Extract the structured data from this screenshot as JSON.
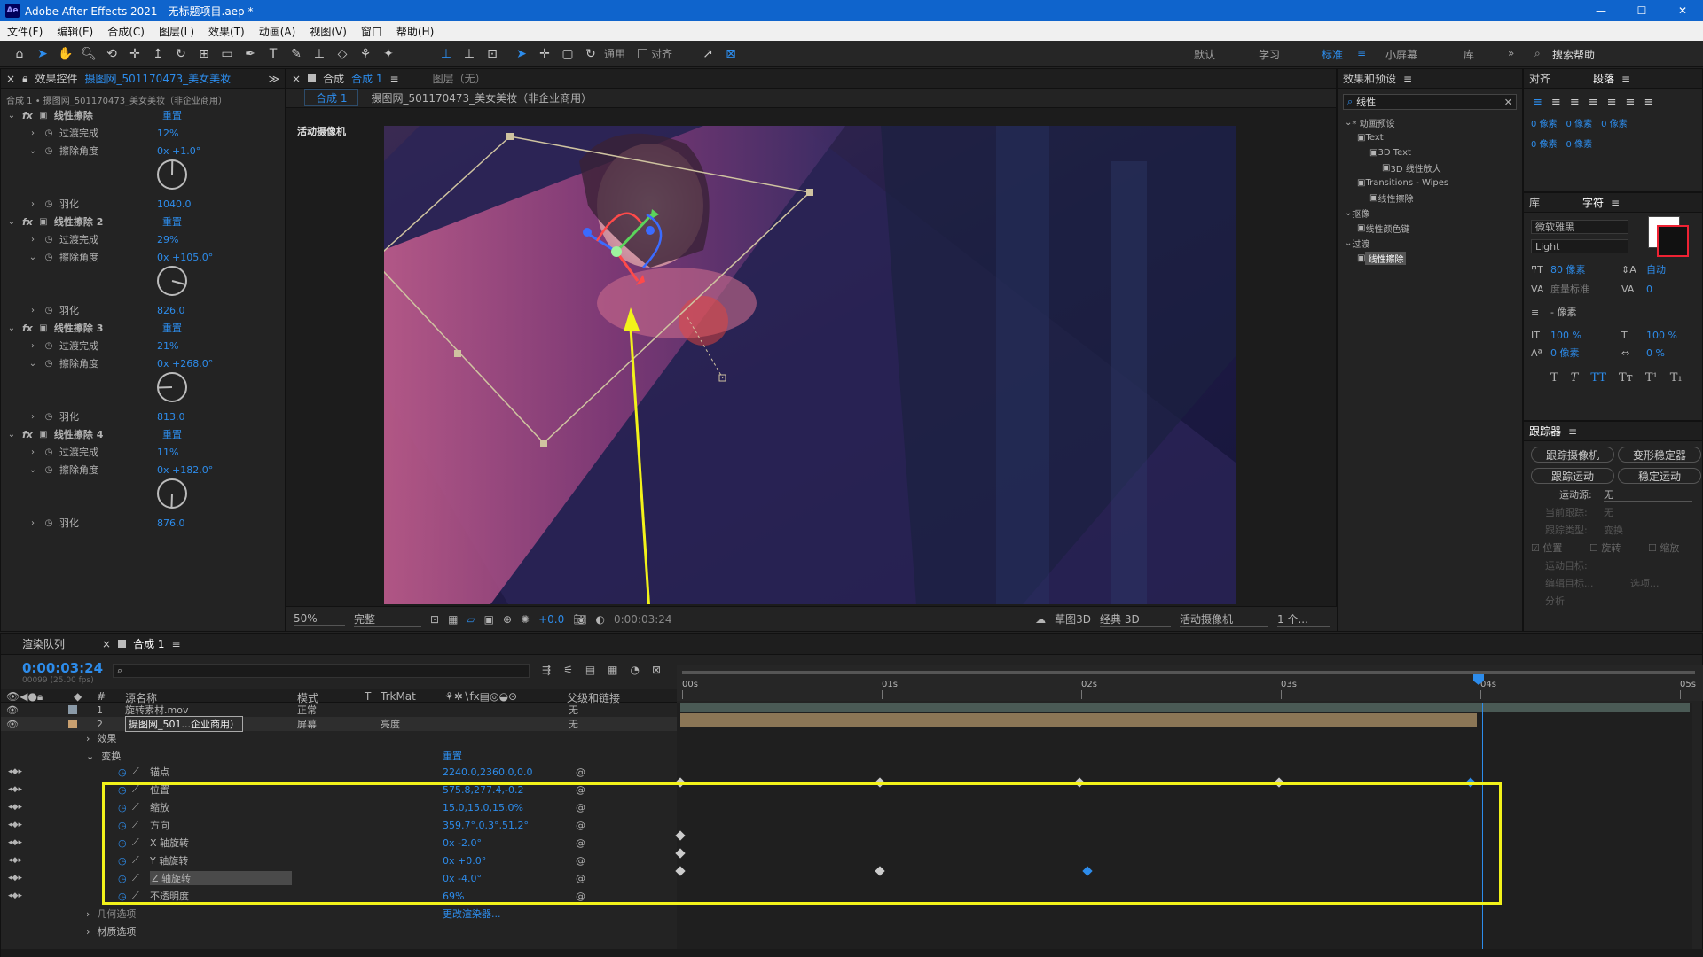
{
  "app": {
    "title": "Adobe After Effects 2021 - 无标题项目.aep *",
    "logo": "Ae",
    "window_controls": [
      "—",
      "☐",
      "✕"
    ]
  },
  "menu": [
    "文件(F)",
    "编辑(E)",
    "合成(C)",
    "图层(L)",
    "效果(T)",
    "动画(A)",
    "视图(V)",
    "窗口",
    "帮助(H)"
  ],
  "toolbar": {
    "snap_label": "对齐",
    "workspaces": [
      "默认",
      "学习",
      "标准",
      "小屏幕",
      "库"
    ],
    "active_workspace": "标准",
    "search_placeholder": "搜索帮助",
    "global_label": "通用"
  },
  "effect_controls": {
    "tab_label": "效果控件",
    "tab_layer": "摄图网_501170473_美女美妆",
    "breadcrumb": "合成 1 • 摄图网_501170473_美女美妆（非企业商用）",
    "effects": [
      {
        "name": "线性擦除",
        "reset": "重置",
        "completion": "12%",
        "angle": "0x +1.0°",
        "feather": "1040.0",
        "dial_deg": 1
      },
      {
        "name": "线性擦除 2",
        "reset": "重置",
        "completion": "29%",
        "angle": "0x +105.0°",
        "feather": "826.0",
        "dial_deg": 105
      },
      {
        "name": "线性擦除 3",
        "reset": "重置",
        "completion": "21%",
        "angle": "0x +268.0°",
        "feather": "813.0",
        "dial_deg": 268
      },
      {
        "name": "线性擦除 4",
        "reset": "重置",
        "completion": "11%",
        "angle": "0x +182.0°",
        "feather": "876.0",
        "dial_deg": 182
      }
    ],
    "prop_completion": "过渡完成",
    "prop_angle": "擦除角度",
    "prop_feather": "羽化"
  },
  "composition": {
    "tab_label": "合成",
    "tab_name": "合成 1",
    "layer_tab": "图层（无）",
    "breadcrumb_comp": "合成 1",
    "breadcrumb_layer": "摄图网_501170473_美女美妆（非企业商用）",
    "camera_label": "活动摄像机",
    "zoom": "50%",
    "quality": "完整",
    "exposure": "+0.0",
    "timecode": "0:00:03:24",
    "draft3d": "草图3D",
    "renderer": "经典 3D",
    "camera": "活动摄像机",
    "views": "1 个..."
  },
  "effects_presets": {
    "tab_label": "效果和预设",
    "search_value": "线性",
    "tree": [
      {
        "label": "* 动画预设",
        "indent": 0
      },
      {
        "label": "Text",
        "indent": 1
      },
      {
        "label": "3D Text",
        "indent": 2
      },
      {
        "label": "3D 线性放大",
        "indent": 3
      },
      {
        "label": "Transitions - Wipes",
        "indent": 1
      },
      {
        "label": "线性擦除",
        "indent": 2
      },
      {
        "label": "抠像",
        "indent": 0
      },
      {
        "label": "线性颜色键",
        "indent": 1
      },
      {
        "label": "过渡",
        "indent": 0
      },
      {
        "label": "线性擦除",
        "indent": 1
      }
    ]
  },
  "align_panel": {
    "tab1": "对齐",
    "tab2": "段落",
    "px_label": "0 像素"
  },
  "character_panel": {
    "tab1": "库",
    "tab2": "字符",
    "font": "微软雅黑",
    "weight": "Light",
    "size": "80 像素",
    "leading": "自动",
    "kerning": "度量标准",
    "tracking": "0",
    "stroke": "- 像素",
    "vscale": "100 %",
    "hscale": "100 %",
    "baseline": "0 像素",
    "tsume": "0 %",
    "styles": [
      "T",
      "T",
      "TT",
      "Tт",
      "T¹",
      "T₁"
    ]
  },
  "tracker_panel": {
    "title": "跟踪器",
    "buttons": [
      "跟踪摄像机",
      "变形稳定器",
      "跟踪运动",
      "稳定运动"
    ],
    "motion_source_label": "运动源:",
    "motion_source_value": "无",
    "current_track_label": "当前跟踪:",
    "current_track_value": "无",
    "track_type_label": "跟踪类型:",
    "track_type_value": "变换",
    "checks": [
      "位置",
      "旋转",
      "缩放"
    ],
    "motion_target_label": "运动目标:",
    "edit_target": "编辑目标...",
    "options": "选项...",
    "analyze": "分析"
  },
  "timeline": {
    "render_queue_tab": "渲染队列",
    "comp_tab": "合成 1",
    "current_time": "0:00:03:24",
    "frame_info": "00099 (25.00 fps)",
    "col_layer_name": "源名称",
    "col_mode": "模式",
    "col_t": "T",
    "col_trkmat": "TrkMat",
    "col_parent": "父级和链接",
    "ruler": [
      "00s",
      "01s",
      "02s",
      "03s",
      "04s",
      "05s"
    ],
    "layers": [
      {
        "num": "1",
        "name": "旋转素材.mov",
        "mode": "正常",
        "trkmat": "",
        "parent": "无"
      },
      {
        "num": "2",
        "name": "摄图网_501...企业商用）",
        "mode": "屏幕",
        "trkmat": "亮度",
        "parent": "无"
      }
    ],
    "groups": [
      "效果",
      "变换"
    ],
    "transform_reset": "重置",
    "props": [
      {
        "name": "锚点",
        "value": "2240.0,2360.0,0.0"
      },
      {
        "name": "位置",
        "value": "575.8,277.4,-0.2"
      },
      {
        "name": "缩放",
        "value": "15.0,15.0,15.0%"
      },
      {
        "name": "方向",
        "value": "359.7°,0.3°,51.2°"
      },
      {
        "name": "X 轴旋转",
        "value": "0x -2.0°"
      },
      {
        "name": "Y 轴旋转",
        "value": "0x +0.0°"
      },
      {
        "name": "Z 轴旋转",
        "value": "0x -4.0°"
      },
      {
        "name": "不透明度",
        "value": "69%"
      }
    ],
    "geometry_options": "几何选项",
    "change_renderer": "更改渲染器...",
    "material_options": "材质选项"
  },
  "colors": {
    "accent_blue": "#2d8ceb",
    "highlight_yellow": "#f2f21a",
    "titlebar": "#0f64cc"
  }
}
